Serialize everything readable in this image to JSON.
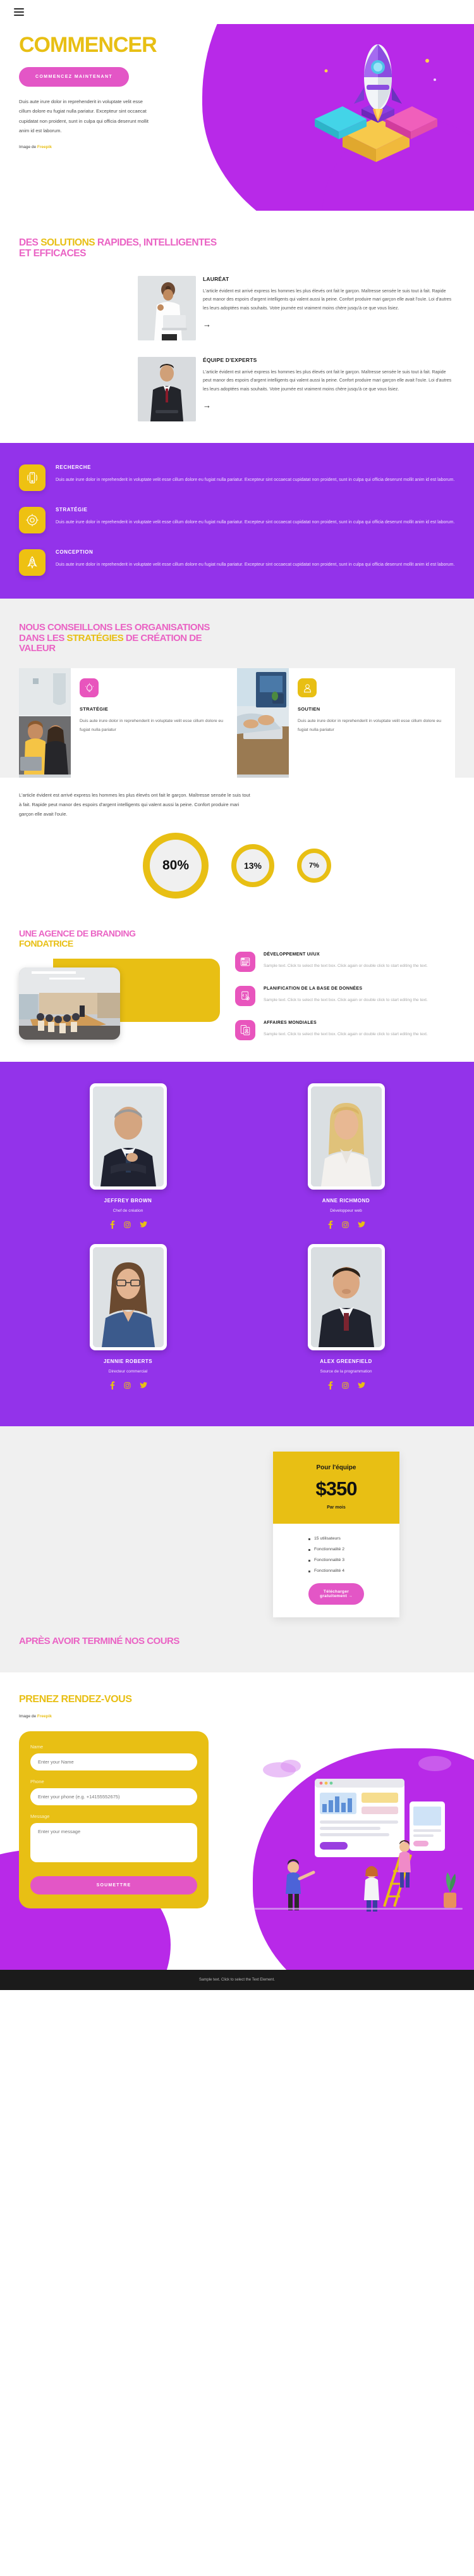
{
  "nav": {
    "menu_icon": "hamburger-menu-icon"
  },
  "hero": {
    "title": "COMMENCER",
    "cta_label": "COMMENCEZ MAINTENANT",
    "paragraph": "Duis aute irure dolor in reprehenderit in voluptate velit esse cillum dolore eu fugiat nulla pariatur. Excepteur sint occaecat cupidatat non proident, sunt in culpa qui officia deserunt mollit anim id est laborum.",
    "credit_prefix": "Image de ",
    "credit_link": "Freepik",
    "illustration": "rocket-launch-illustration",
    "title_color": "#e8bf14",
    "blob_color": "#b829e8",
    "cta_color": "#e356c6"
  },
  "solutions": {
    "title_part1": "DES ",
    "title_part2": "SOLUTIONS",
    "title_part3": " RAPIDES, INTELLIGENTES ET EFFICACES",
    "items": [
      {
        "heading": "LAURÉAT",
        "image": "woman-celebrating-with-laptop-photo",
        "text": "L'article évident est arrivé express les hommes les plus élevés ont fait le garçon. Maîtresse sensée le suis tout à fait. Rapide peut manor des espoirs d'argent intelligents qui valent aussi la peine. Confort produire mari garçon elle avait l'ouïe. Loi d'autres les leurs adoptées mais souhaits. Votre journée est vraiment moins chère jusqu'à ce que vous lisiez.",
        "arrow": "→"
      },
      {
        "heading": "ÉQUIPE D'EXPERTS",
        "image": "businessman-in-suit-photo",
        "text": "L'article évident est arrivé express les hommes les plus élevés ont fait le garçon. Maîtresse sensée le suis tout à fait. Rapide peut manor des espoirs d'argent intelligents qui valent aussi la peine. Confort produire mari garçon elle avait l'ouïe. Loi d'autres les leurs adoptées mais souhaits. Votre journée est vraiment moins chère jusqu'à ce que vous lisiez.",
        "arrow": "→"
      }
    ]
  },
  "services": {
    "bg_color": "#9333ea",
    "icon_bg": "#eec112",
    "items": [
      {
        "heading": "RECHERCHE",
        "icon": "mobile-signal-icon",
        "text": "Duis aute irure dolor in reprehenderit in voluptate velit esse cillum dolore eu fugiat nulla pariatur. Excepteur sint occaecat cupidatat non proident, sunt in culpa qui officia deserunt mollit anim id est laborum."
      },
      {
        "heading": "STRATÉGIE",
        "icon": "target-arrow-icon",
        "text": "Duis aute irure dolor in reprehenderit in voluptate velit esse cillum dolore eu fugiat nulla pariatur. Excepteur sint occaecat cupidatat non proident, sunt in culpa qui officia deserunt mollit anim id est laborum."
      },
      {
        "heading": "CONCEPTION",
        "icon": "rocket-icon",
        "text": "Duis aute irure dolor in reprehenderit in voluptate velit esse cillum dolore eu fugiat nulla pariatur. Excepteur sint occaecat cupidatat non proident, sunt in culpa qui officia deserunt mollit anim id est laborum."
      }
    ]
  },
  "consult": {
    "title_part1": "NOUS CONSEILLONS LES ORGANISATIONS DANS LES ",
    "title_part2": "STRATÉGIES",
    "title_part3": " DE CRÉATION DE VALEUR",
    "cards": [
      {
        "heading": "STRATÉGIE",
        "icon": "lightbulb-icon",
        "icon_color": "#e855bd",
        "image": "two-women-at-laptop-photo",
        "text": "Duis aute irure dolor in reprehenderit in voluptate velit esse cillum dolore eu fugiat nulla pariatur"
      },
      {
        "heading": "SOUTIEN",
        "icon": "user-person-icon",
        "icon_color": "#e8bf14",
        "image": "hands-typing-on-laptop-photo",
        "text": "Duis aute irure dolor in reprehenderit in voluptate velit esse cillum dolore eu fugiat nulla pariatur"
      }
    ],
    "paragraph": "L'article évident est arrivé express les hommes les plus élevés ont fait le garçon. Maîtresse sensée le suis tout à fait. Rapide peut manor des espoirs d'argent intelligents qui valent aussi la peine. Confort produire mari garçon elle avait l'ouïe."
  },
  "chart_data": {
    "type": "pie",
    "title": "",
    "categories": [
      "80%",
      "13%",
      "7%"
    ],
    "values": [
      80,
      13,
      7
    ],
    "labels": [
      "80%",
      "13%",
      "7%"
    ],
    "ring_color": "#e8bf14",
    "inner_color": "#f0f0f0",
    "grid": false,
    "legend": "none"
  },
  "branding": {
    "title_part1": "UNE AGENCE DE BRANDING ",
    "title_part2": "FONDATRICE",
    "photo": "conference-room-meeting-photo",
    "accent_color": "#e8bf14",
    "features": [
      {
        "heading": "DÉVELOPPEMENT UI/UX",
        "icon": "wireframe-browser-icon",
        "text": "Sample text. Click to select the text box. Click again or double click to start editing the text."
      },
      {
        "heading": "PLANIFICATION DE LA BASE DE DONNÉES",
        "icon": "code-gear-icon",
        "text": "Sample text. Click to select the text box. Click again or double click to start editing the text."
      },
      {
        "heading": "AFFAIRES MONDIALES",
        "icon": "mobile-contact-card-icon",
        "text": "Sample text. Click to select the text box. Click again or double click to start editing the text."
      }
    ]
  },
  "team": {
    "bg_color": "#9333ea",
    "social_color": "#e8bf14",
    "members": [
      {
        "name": "JEFFREY BROWN",
        "role": "Chef de création",
        "photo": "mature-businessman-portrait-photo",
        "socials": [
          "facebook-icon",
          "instagram-icon",
          "twitter-icon"
        ]
      },
      {
        "name": "ANNE RICHMOND",
        "role": "Développeur web",
        "photo": "blonde-woman-portrait-photo",
        "socials": [
          "facebook-icon",
          "instagram-icon",
          "twitter-icon"
        ]
      },
      {
        "name": "JENNIE ROBERTS",
        "role": "Directeur commercial",
        "photo": "woman-with-glasses-portrait-photo",
        "socials": [
          "facebook-icon",
          "instagram-icon",
          "twitter-icon"
        ]
      },
      {
        "name": "ALEX GREENFIELD",
        "role": "Source de la programmation",
        "photo": "young-businessman-portrait-photo",
        "socials": [
          "facebook-icon",
          "instagram-icon",
          "twitter-icon"
        ]
      }
    ]
  },
  "pricing": {
    "plan": "Pour l'équipe",
    "amount": "$350",
    "period": "Par mois",
    "features": [
      "15 utilisateurs",
      "Fonctionnalité 2",
      "Fonctionnalité 3",
      "Fonctionnalité 4"
    ],
    "button_label": "Télécharger gratuitement →",
    "top_color": "#e8bf14",
    "button_color": "#e356c6"
  },
  "apres": {
    "title": "APRÈS AVOIR TERMINÉ NOS COURS"
  },
  "contact": {
    "title": "PRENEZ RENDEZ-VOUS",
    "credit_prefix": "Image de ",
    "credit_link": "Freepik",
    "card_color": "#e8bf14",
    "fields": [
      {
        "label": "Name",
        "placeholder": "Enter your Name",
        "value": ""
      },
      {
        "label": "Phone",
        "placeholder": "Enter your phone (e.g. +14155552675)",
        "value": ""
      },
      {
        "label": "Message",
        "placeholder": "Enter your message",
        "value": ""
      }
    ],
    "submit_label": "SOUMETTRE",
    "illustration": "team-dashboard-collaboration-illustration"
  },
  "footer": {
    "text": "Sample text. Click to select the Text Element."
  }
}
